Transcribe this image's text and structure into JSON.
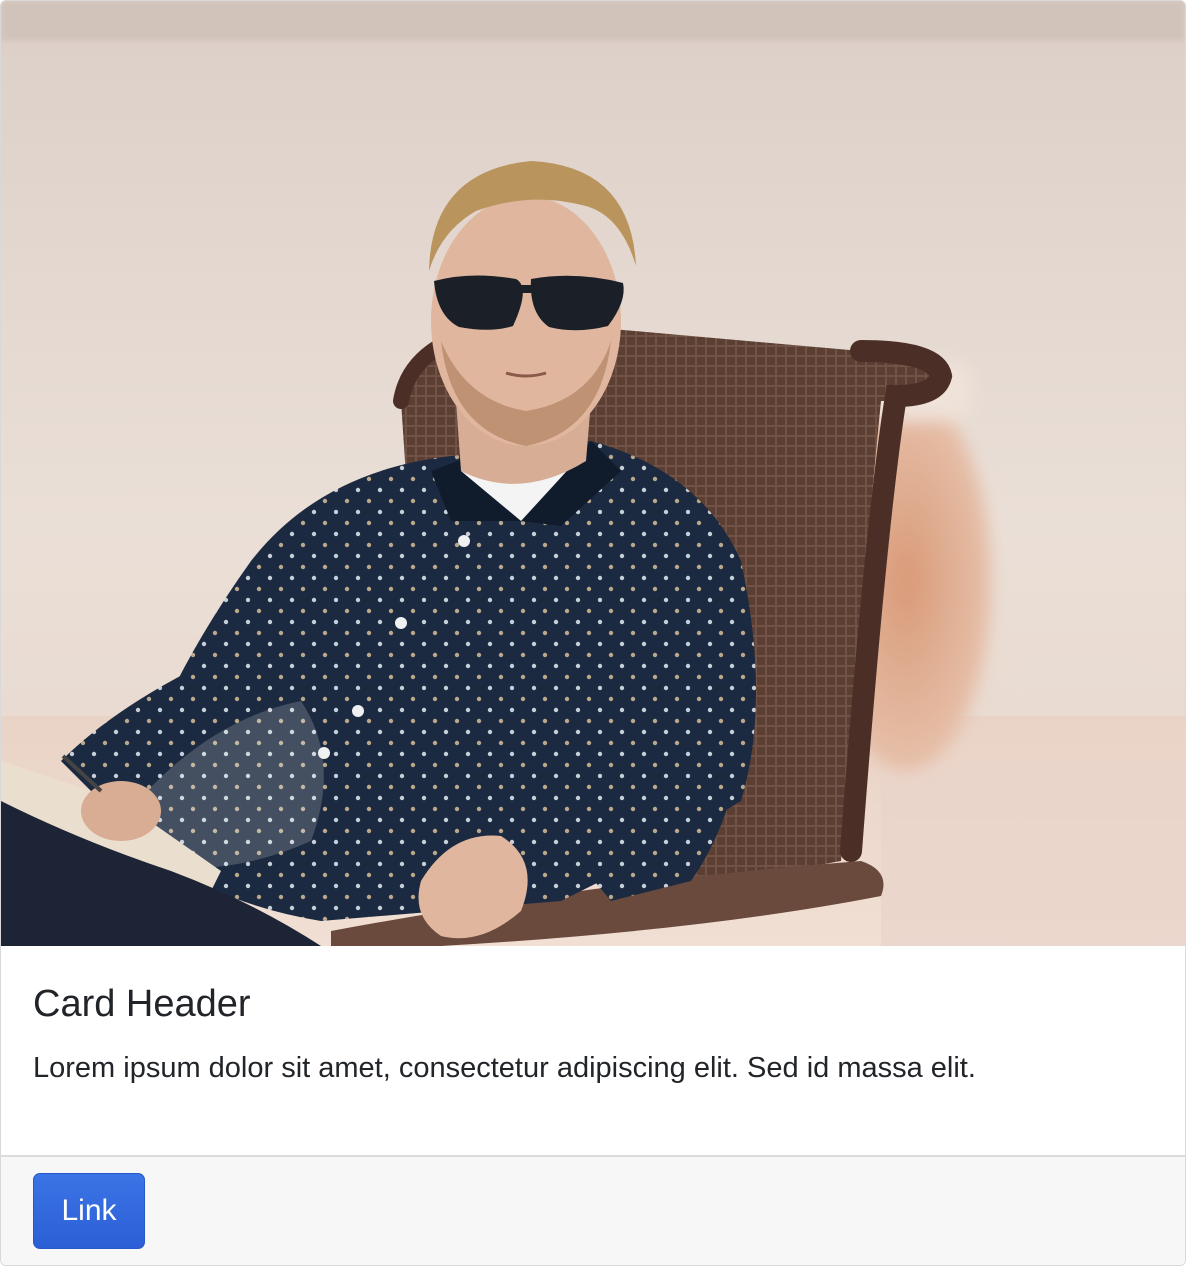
{
  "card": {
    "image_alt": "Man in sunglasses and dotted navy shirt relaxing in a wicker chair",
    "title": "Card Header",
    "text": "Lorem ipsum dolor sit amet, consectetur adipiscing elit. Sed id massa elit.",
    "footer_button_label": "Link"
  },
  "colors": {
    "button_primary": "#2c5fd6",
    "footer_background": "#f7f7f7",
    "text_primary": "#212529"
  }
}
